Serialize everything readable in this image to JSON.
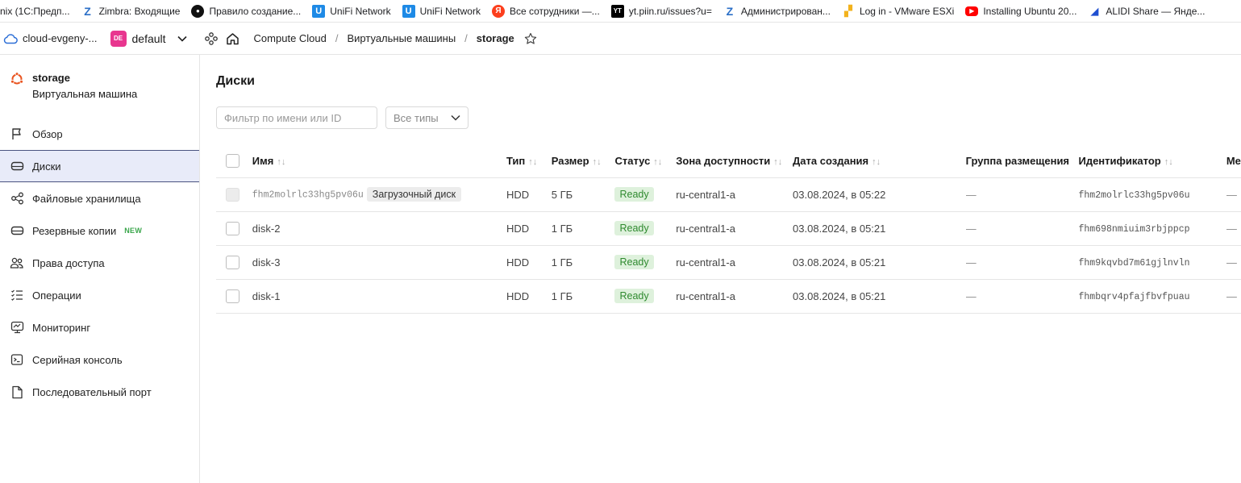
{
  "bookmarks": [
    {
      "label": "nix (1С:Предп...",
      "icon": "none"
    },
    {
      "label": "Zimbra: Входящие",
      "icon": "zimbra-icon"
    },
    {
      "label": "Правило создание...",
      "icon": "github-icon"
    },
    {
      "label": "UniFi Network",
      "icon": "unifi-icon"
    },
    {
      "label": "UniFi Network",
      "icon": "unifi-icon"
    },
    {
      "label": "Все сотрудники —...",
      "icon": "yandex-icon"
    },
    {
      "label": "yt.piin.ru/issues?u=",
      "icon": "youtrack-icon"
    },
    {
      "label": "Администрирован...",
      "icon": "zimbra-icon"
    },
    {
      "label": "Log in - VMware ESXi",
      "icon": "vmware-icon"
    },
    {
      "label": "Installing Ubuntu 20...",
      "icon": "youtube-icon"
    },
    {
      "label": "ALIDI Share — Янде...",
      "icon": "share-icon"
    }
  ],
  "header": {
    "cloud_name": "cloud-evgeny-...",
    "folder_badge": "DE",
    "folder_name": "default",
    "breadcrumbs": [
      "Compute Cloud",
      "Виртуальные машины",
      "storage"
    ]
  },
  "sidebar": {
    "vm_name": "storage",
    "vm_type": "Виртуальная машина",
    "items": [
      {
        "label": "Обзор",
        "icon": "flag-icon"
      },
      {
        "label": "Диски",
        "icon": "disk-icon",
        "active": true
      },
      {
        "label": "Файловые хранилища",
        "icon": "nodes-icon"
      },
      {
        "label": "Резервные копии",
        "icon": "backup-icon",
        "badge": "NEW"
      },
      {
        "label": "Права доступа",
        "icon": "users-icon"
      },
      {
        "label": "Операции",
        "icon": "list-icon"
      },
      {
        "label": "Мониторинг",
        "icon": "monitor-icon"
      },
      {
        "label": "Серийная консоль",
        "icon": "console-icon"
      },
      {
        "label": "Последовательный порт",
        "icon": "document-icon"
      }
    ]
  },
  "main": {
    "title": "Диски",
    "filter_placeholder": "Фильтр по имени или ID",
    "type_select": "Все типы",
    "columns": [
      "Имя",
      "Тип",
      "Размер",
      "Статус",
      "Зона доступности",
      "Дата создания",
      "Группа размещения",
      "Идентификатор",
      "Ме"
    ],
    "rows": [
      {
        "name": "fhm2molrlc33hg5pv06u",
        "badge": "Загрузочный диск",
        "type": "HDD",
        "size": "5 ГБ",
        "status": "Ready",
        "zone": "ru-central1-a",
        "created": "03.08.2024, в 05:22",
        "group": "—",
        "id": "fhm2molrlc33hg5pv06u",
        "extra": "—"
      },
      {
        "name": "disk-2",
        "badge": "",
        "type": "HDD",
        "size": "1 ГБ",
        "status": "Ready",
        "zone": "ru-central1-a",
        "created": "03.08.2024, в 05:21",
        "group": "—",
        "id": "fhm698nmiuim3rbjppcp",
        "extra": "—"
      },
      {
        "name": "disk-3",
        "badge": "",
        "type": "HDD",
        "size": "1 ГБ",
        "status": "Ready",
        "zone": "ru-central1-a",
        "created": "03.08.2024, в 05:21",
        "group": "—",
        "id": "fhm9kqvbd7m61gjlnvln",
        "extra": "—"
      },
      {
        "name": "disk-1",
        "badge": "",
        "type": "HDD",
        "size": "1 ГБ",
        "status": "Ready",
        "zone": "ru-central1-a",
        "created": "03.08.2024, в 05:21",
        "group": "—",
        "id": "fhmbqrv4pfajfbvfpuau",
        "extra": "—"
      }
    ]
  },
  "colors": {
    "accent": "#4a5380",
    "active_bg": "#e8ebf9",
    "ready_bg": "#def1dc",
    "ready_text": "#2f8a2f",
    "new_badge": "#3aa64b",
    "folder_badge": "#e8368f",
    "ubuntu": "#e95420"
  }
}
